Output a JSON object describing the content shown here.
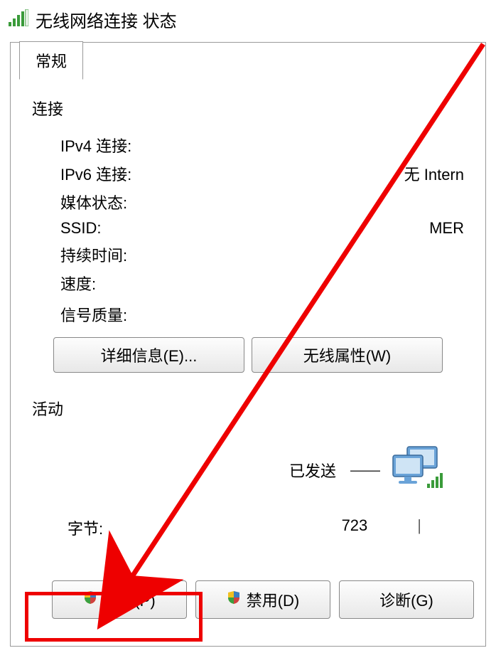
{
  "window": {
    "title": "无线网络连接 状态"
  },
  "tab": {
    "general": "常规"
  },
  "connection": {
    "section_title": "连接",
    "ipv4_label": "IPv4 连接:",
    "ipv6_label": "IPv6 连接:",
    "ipv6_value": "无 Intern",
    "media_label": "媒体状态:",
    "ssid_label": "SSID:",
    "ssid_value": "MER",
    "duration_label": "持续时间:",
    "speed_label": "速度:",
    "signal_label": "信号质量:"
  },
  "buttons": {
    "details": "详细信息(E)...",
    "wireless_props": "无线属性(W)"
  },
  "activity": {
    "section_title": "活动",
    "sent_label": "已发送",
    "bytes_label": "字节:",
    "bytes_sent": "723",
    "separator": "|"
  },
  "bottom_buttons": {
    "properties": "属性(P)",
    "disable": "禁用(D)",
    "diagnose": "诊断(G)"
  },
  "icons": {
    "signal": "signal-bars-icon",
    "computer": "network-computers-icon",
    "shield": "uac-shield-icon"
  }
}
